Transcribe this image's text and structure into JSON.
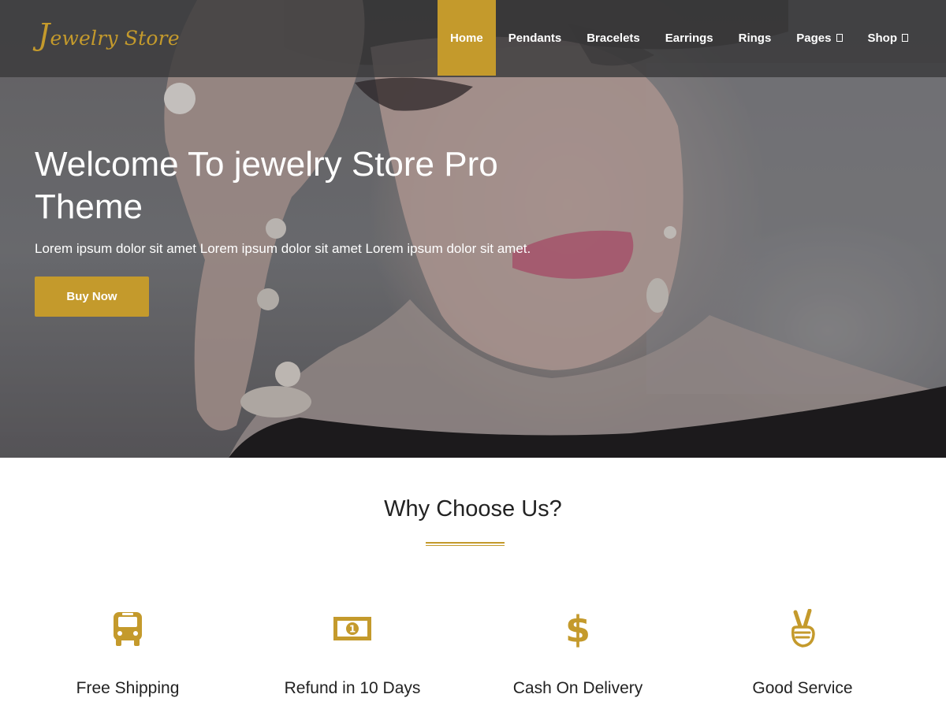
{
  "header": {
    "logo_big": "J",
    "logo_rest": "ewelry Store",
    "nav": [
      {
        "label": "Home"
      },
      {
        "label": "Pendants"
      },
      {
        "label": "Bracelets"
      },
      {
        "label": "Earrings"
      },
      {
        "label": "Rings"
      },
      {
        "label": "Pages"
      },
      {
        "label": "Shop"
      }
    ]
  },
  "hero": {
    "title": "Welcome To jewelry Store Pro Theme",
    "subtitle": "Lorem ipsum dolor sit amet Lorem ipsum dolor sit amet Lorem ipsum dolor sit amet.",
    "button_label": "Buy Now"
  },
  "why": {
    "title": "Why Choose Us?",
    "features": [
      {
        "label": "Free Shipping",
        "icon": "bus-icon"
      },
      {
        "label": "Refund in 10 Days",
        "icon": "money-bill-icon"
      },
      {
        "label": "Cash On Delivery",
        "icon": "dollar-icon"
      },
      {
        "label": "Good Service",
        "icon": "peace-hand-icon"
      }
    ]
  },
  "colors": {
    "accent": "#c49a2c",
    "header_bg": "#3a3a3c",
    "text_dark": "#222222"
  }
}
